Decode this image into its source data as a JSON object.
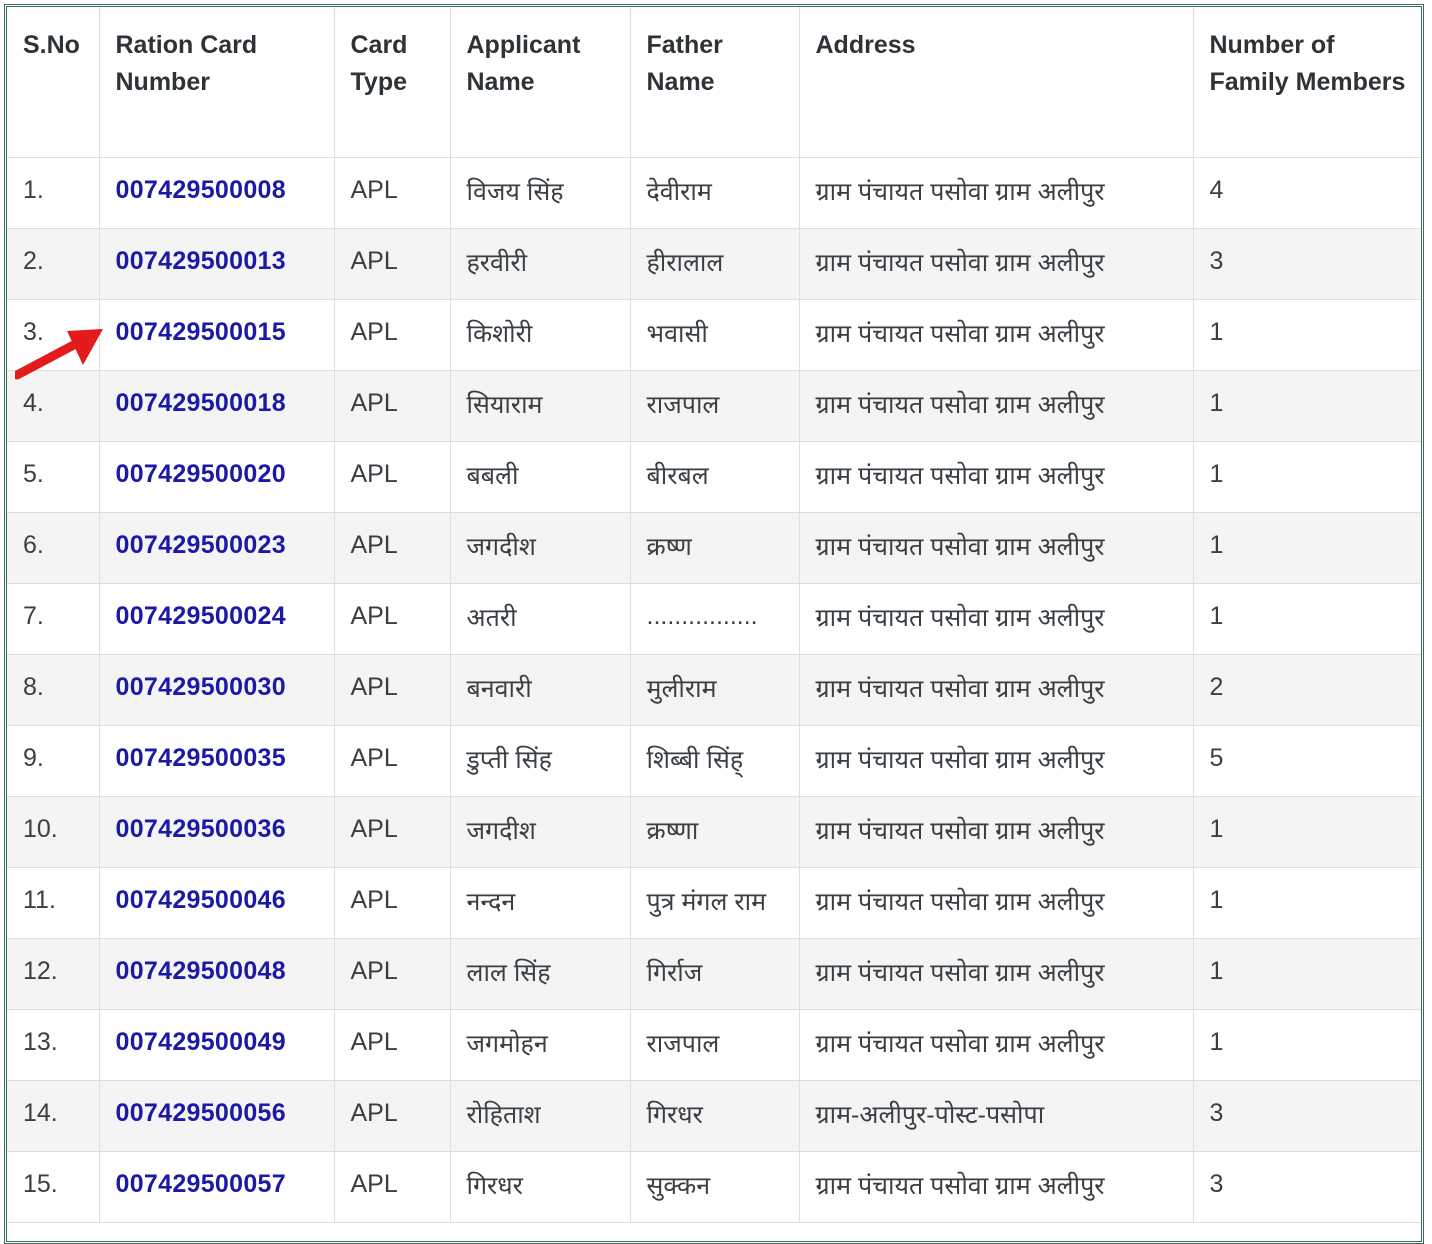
{
  "table": {
    "headers": {
      "sno": "S.No",
      "ration_card_number": "Ration Card Number",
      "card_type": "Card Type",
      "applicant_name": "Applicant Name",
      "father_name": "Father Name",
      "address": "Address",
      "family_members": "Number of Family Members"
    },
    "rows": [
      {
        "sno": "1.",
        "card": "007429500008",
        "type": "APL",
        "applicant": "विजय सिंह",
        "father": "देवीराम",
        "address": "ग्राम पंचायत पसोवा ग्राम अलीपुर",
        "members": "4"
      },
      {
        "sno": "2.",
        "card": "007429500013",
        "type": "APL",
        "applicant": "हरवीरी",
        "father": "हीरालाल",
        "address": "ग्राम पंचायत पसोवा ग्राम अलीपुर",
        "members": "3"
      },
      {
        "sno": "3.",
        "card": "007429500015",
        "type": "APL",
        "applicant": "किशोरी",
        "father": "भवासी",
        "address": "ग्राम पंचायत पसोवा ग्राम अलीपुर",
        "members": "1"
      },
      {
        "sno": "4.",
        "card": "007429500018",
        "type": "APL",
        "applicant": "सियाराम",
        "father": "राजपाल",
        "address": "ग्राम पंचायत पसोवा ग्राम अलीपुर",
        "members": "1"
      },
      {
        "sno": "5.",
        "card": "007429500020",
        "type": "APL",
        "applicant": "बबली",
        "father": "बीरबल",
        "address": "ग्राम पंचायत पसोवा ग्राम अलीपुर",
        "members": "1"
      },
      {
        "sno": "6.",
        "card": "007429500023",
        "type": "APL",
        "applicant": "जगदीश",
        "father": "क्रष्ण",
        "address": "ग्राम पंचायत पसोवा ग्राम अलीपुर",
        "members": "1"
      },
      {
        "sno": "7.",
        "card": "007429500024",
        "type": "APL",
        "applicant": "अतरी",
        "father": "................",
        "address": "ग्राम पंचायत पसोवा ग्राम अलीपुर",
        "members": "1"
      },
      {
        "sno": "8.",
        "card": "007429500030",
        "type": "APL",
        "applicant": "बनवारी",
        "father": "मुलीराम",
        "address": "ग्राम पंचायत पसोवा ग्राम अलीपुर",
        "members": "2"
      },
      {
        "sno": "9.",
        "card": "007429500035",
        "type": "APL",
        "applicant": "डुप्ती सिंह",
        "father": "शिब्बी सिंह्",
        "address": "ग्राम पंचायत पसोवा ग्राम अलीपुर",
        "members": "5"
      },
      {
        "sno": "10.",
        "card": "007429500036",
        "type": "APL",
        "applicant": "जगदीश",
        "father": "क्रष्णा",
        "address": "ग्राम पंचायत पसोवा ग्राम अलीपुर",
        "members": "1"
      },
      {
        "sno": "11.",
        "card": "007429500046",
        "type": "APL",
        "applicant": "नन्दन",
        "father": "पुत्र मंगल राम",
        "address": "ग्राम पंचायत पसोवा ग्राम अलीपुर",
        "members": "1"
      },
      {
        "sno": "12.",
        "card": "007429500048",
        "type": "APL",
        "applicant": "लाल सिंह",
        "father": "गिर्राज",
        "address": "ग्राम पंचायत पसोवा ग्राम अलीपुर",
        "members": "1"
      },
      {
        "sno": "13.",
        "card": "007429500049",
        "type": "APL",
        "applicant": "जगमोहन",
        "father": "राजपाल",
        "address": "ग्राम पंचायत पसोवा ग्राम अलीपुर",
        "members": "1"
      },
      {
        "sno": "14.",
        "card": "007429500056",
        "type": "APL",
        "applicant": "रोहिताश",
        "father": "गिरधर",
        "address": "ग्राम-अलीपुर-पोस्ट-पसोपा",
        "members": "3"
      },
      {
        "sno": "15.",
        "card": "007429500057",
        "type": "APL",
        "applicant": "गिरधर",
        "father": "सुक्कन",
        "address": "ग्राम पंचायत पसोवा ग्राम अलीपुर",
        "members": "3"
      }
    ]
  },
  "annotation": {
    "arrow_color": "#e31b1b",
    "points_to_row": 3
  }
}
